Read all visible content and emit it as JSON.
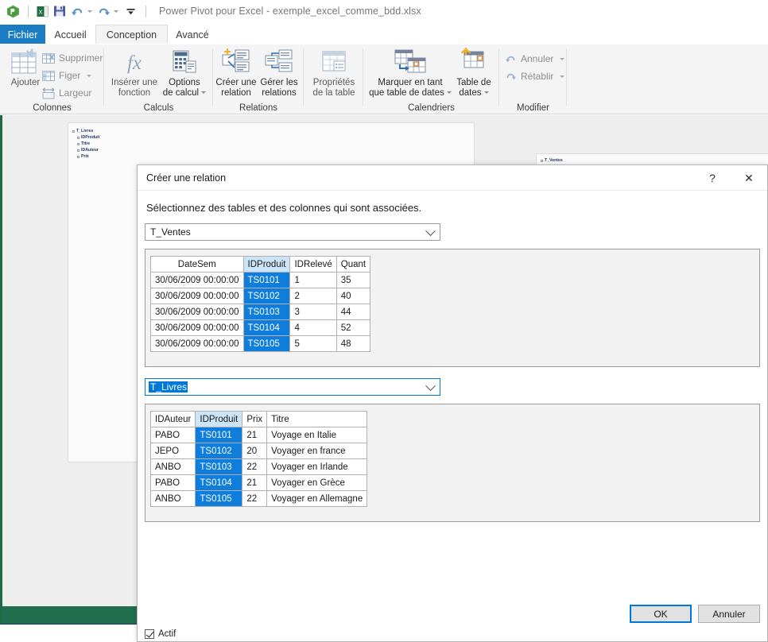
{
  "titlebar": {
    "app_icon": "power-pivot-icon",
    "quick_access": [
      {
        "name": "excel-icon",
        "label": "Excel"
      },
      {
        "name": "save-icon",
        "label": "Enregistrer"
      },
      {
        "name": "undo-icon",
        "label": "Annuler"
      },
      {
        "name": "redo-icon",
        "label": "Rétablir"
      },
      {
        "name": "customize-qat-icon",
        "label": "Personnaliser la barre d'outils Accès rapide"
      }
    ],
    "title": "Power Pivot pour Excel - exemple_excel_comme_bdd.xlsx"
  },
  "tabs": [
    {
      "label": "Fichier",
      "state": "file"
    },
    {
      "label": "Accueil",
      "state": "normal"
    },
    {
      "label": "Conception",
      "state": "active"
    },
    {
      "label": "Avancé",
      "state": "normal"
    }
  ],
  "ribbon": {
    "groups": [
      {
        "label": "Colonnes",
        "big": [
          {
            "label": "Ajouter",
            "icon": "add-column-icon",
            "enabled": false
          }
        ],
        "small": [
          {
            "label": "Supprimer",
            "icon": "delete-column-icon",
            "enabled": false,
            "caret": false
          },
          {
            "label": "Figer",
            "icon": "freeze-column-icon",
            "enabled": false,
            "caret": true
          },
          {
            "label": "Largeur",
            "icon": "column-width-icon",
            "enabled": false,
            "caret": false
          }
        ]
      },
      {
        "label": "Calculs",
        "big": [
          {
            "label": "Insérer une\nfonction",
            "icon": "fx-icon",
            "enabled": false
          },
          {
            "label": "Options\nde calcul",
            "icon": "calc-options-icon",
            "enabled": true,
            "caret": true
          }
        ],
        "small": []
      },
      {
        "label": "Relations",
        "big": [
          {
            "label": "Créer une\nrelation",
            "icon": "create-relationship-icon",
            "enabled": true
          },
          {
            "label": "Gérer les\nrelations",
            "icon": "manage-relationships-icon",
            "enabled": true
          }
        ],
        "small": []
      },
      {
        "label": "",
        "big": [
          {
            "label": "Propriétés\nde la table",
            "icon": "table-properties-icon",
            "enabled": false
          }
        ],
        "small": []
      },
      {
        "label": "Calendriers",
        "big": [
          {
            "label": "Marquer en tant\nque table de dates",
            "icon": "mark-as-date-table-icon",
            "enabled": true,
            "caret": true
          },
          {
            "label": "Table de\ndates",
            "icon": "date-table-icon",
            "enabled": true,
            "caret": true
          }
        ],
        "small": []
      },
      {
        "label": "Modifier",
        "big": [],
        "small": [
          {
            "label": "Annuler",
            "icon": "undo-icon",
            "enabled": false,
            "caret": true
          },
          {
            "label": "Rétablir",
            "icon": "redo-icon",
            "enabled": false,
            "caret": true
          }
        ]
      }
    ]
  },
  "workspace": {
    "diagram_tables": [
      {
        "title": "T_Livres",
        "columns": [
          "IDProduit",
          "Titre",
          "IDAuteur",
          "Prix"
        ]
      },
      {
        "title": "T_Ventes",
        "columns": []
      }
    ]
  },
  "dialog": {
    "title": "Créer une relation",
    "help_glyph": "?",
    "close_glyph": "✕",
    "instruction": "Sélectionnez des tables et des colonnes qui sont associées.",
    "table1": {
      "combo_value": "T_Ventes",
      "combo_focused": false,
      "columns": [
        "DateSem",
        "IDProduit",
        "IDRelevé",
        "Quant"
      ],
      "selected_column": "IDProduit",
      "rows": [
        [
          "30/06/2009 00:00:00",
          "TS0101",
          "1",
          "35"
        ],
        [
          "30/06/2009 00:00:00",
          "TS0102",
          "2",
          "40"
        ],
        [
          "30/06/2009 00:00:00",
          "TS0103",
          "3",
          "44"
        ],
        [
          "30/06/2009 00:00:00",
          "TS0104",
          "4",
          "52"
        ],
        [
          "30/06/2009 00:00:00",
          "TS0105",
          "5",
          "48"
        ]
      ]
    },
    "table2": {
      "combo_value": "T_Livres",
      "combo_focused": true,
      "columns": [
        "IDAuteur",
        "IDProduit",
        "Prix",
        "Titre"
      ],
      "selected_column": "IDProduit",
      "rows": [
        [
          "PABO",
          "TS0101",
          "21",
          "Voyage en Italie"
        ],
        [
          "JEPO",
          "TS0102",
          "20",
          "Voyager en france"
        ],
        [
          "ANBO",
          "TS0103",
          "22",
          "Voyager en Irlande"
        ],
        [
          "PABO",
          "TS0104",
          "21",
          "Voyager en Grèce"
        ],
        [
          "ANBO",
          "TS0105",
          "22",
          "Voyager en Allemagne"
        ]
      ]
    },
    "active_checkbox": {
      "label": "Actif",
      "checked": true
    },
    "ok_label": "OK",
    "cancel_label": "Annuler"
  },
  "colors": {
    "accent_blue": "#0078d7",
    "tab_file_blue": "#1a7dc4",
    "selected_cell": "#0f7ddb",
    "selected_header": "#cce4f7",
    "status_green": "#216e4e",
    "ribbon_bg": "#f4f4f4",
    "workspace_bg": "#eeeeee"
  }
}
